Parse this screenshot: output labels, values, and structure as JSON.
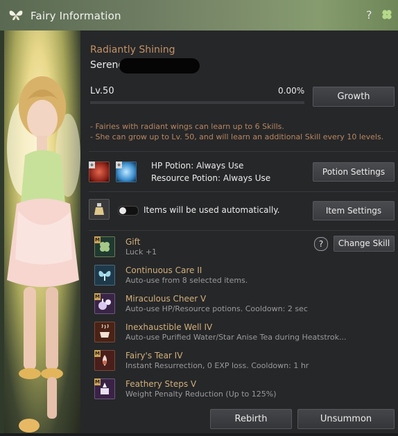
{
  "window": {
    "title": "Fairy Information",
    "help_symbol": "?"
  },
  "fairy": {
    "title": "Radiantly Shining",
    "name": "Serene",
    "level": "Lv.50",
    "exp_percent": "0.00%",
    "exp_fraction": 0.0,
    "info_lines": [
      "- Fairies with radiant wings can learn up to 6 Skills.",
      "- She can grow up to Lv. 50, and will learn an additional Skill every 10 levels."
    ]
  },
  "buttons": {
    "growth": "Growth",
    "potion_settings": "Potion Settings",
    "item_settings": "Item Settings",
    "change_skill": "Change Skill",
    "rebirth": "Rebirth",
    "unsummon": "Unsummon"
  },
  "potions": {
    "hp": "HP Potion: Always Use",
    "resource": "Resource Potion: Always Use"
  },
  "items": {
    "auto_text": "Items will be used automatically.",
    "toggle_on": false
  },
  "skills_help_symbol": "?",
  "skills": [
    {
      "name": "Gift",
      "desc": "Luck +1",
      "icon": "clover-icon",
      "badge": "M"
    },
    {
      "name": "Continuous Care II",
      "desc": "Auto-use from 8 selected items.",
      "icon": "fairy-icon",
      "badge": ""
    },
    {
      "name": "Miraculous Cheer V",
      "desc": "Auto-use HP/Resource potions. Cooldown: 2 sec",
      "icon": "potions-icon",
      "badge": "M"
    },
    {
      "name": "Inexhaustible Well IV",
      "desc": "Auto-use Purified Water/Star Anise Tea during Heatstrok...",
      "icon": "well-icon",
      "badge": ""
    },
    {
      "name": "Fairy's Tear IV",
      "desc": "Instant Resurrection, 0 EXP loss. Cooldown: 1 hr",
      "icon": "tear-icon",
      "badge": "M"
    },
    {
      "name": "Feathery Steps V",
      "desc": "Weight Penalty Reduction (Up to 125%)",
      "icon": "feather-icon",
      "badge": "M"
    }
  ]
}
